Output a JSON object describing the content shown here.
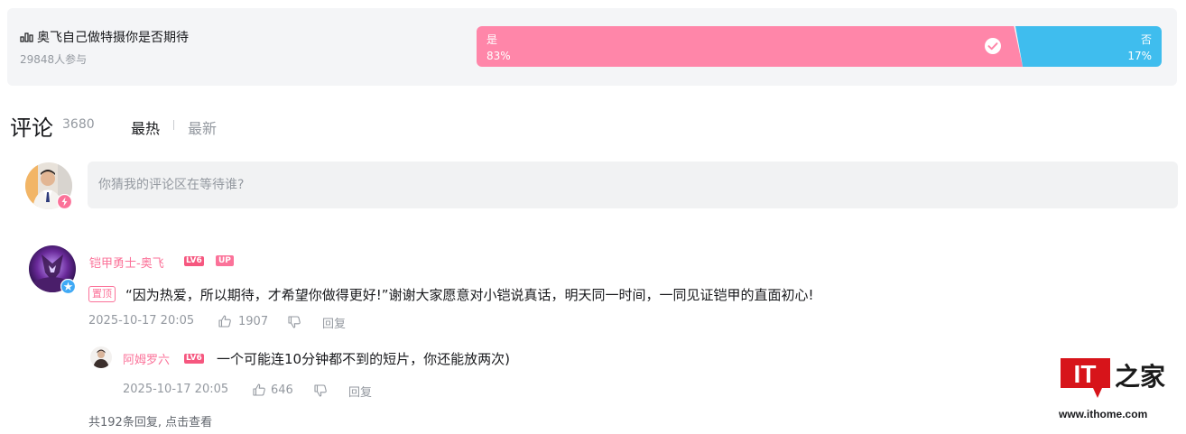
{
  "vote": {
    "question": "奥飞自己做特摄你是否期待",
    "participants": "29848人参与",
    "yes": {
      "label": "是",
      "percent": "83%",
      "selected": true
    },
    "no": {
      "label": "否",
      "percent": "17%"
    },
    "colors": {
      "yes": "#ff86a9",
      "no": "#3fbdee"
    }
  },
  "comments_header": {
    "title": "评论",
    "count": "3680",
    "sort_hot": "最热",
    "sort_new": "最新"
  },
  "reply_box": {
    "placeholder": "你猜我的评论区在等待谁?"
  },
  "comment": {
    "username": "铠甲勇士-奥飞",
    "level": "LV6",
    "up_badge": "UP",
    "pinned_tag": "置顶",
    "text": "“因为热爱，所以期待，才希望你做得更好!”谢谢大家愿意对小铠说真话，明天同一时间，一同见证铠甲的直面初心!",
    "time": "2025-10-17 20:05",
    "likes": "1907",
    "reply_label": "回复",
    "sub_reply": {
      "username": "阿姆罗六",
      "level": "LV6",
      "text": "一个可能连10分钟都不到的短片，你还能放两次)",
      "time": "2025-10-17 20:05",
      "likes": "646",
      "reply_label": "回复"
    },
    "more_replies": "共192条回复, 点击查看"
  },
  "watermark": {
    "logo_text": "IT之家",
    "url": "www.ithome.com"
  },
  "accent": {
    "pink": "#fb7299",
    "gray": "#9499a0"
  }
}
